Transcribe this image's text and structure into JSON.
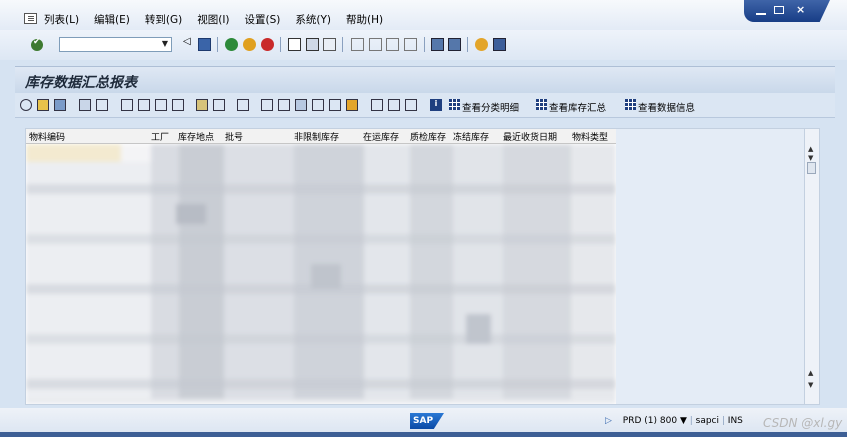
{
  "menubar": {
    "items": [
      "列表(L)",
      "编辑(E)",
      "转到(G)",
      "视图(I)",
      "设置(S)",
      "系统(Y)",
      "帮助(H)"
    ]
  },
  "standard_toolbar": {
    "command_field_value": ""
  },
  "title": "库存数据汇总报表",
  "app_toolbar": {
    "buttons": [
      "查看分类明细",
      "查看库存汇总",
      "查看数据信息"
    ]
  },
  "grid": {
    "columns": [
      "物料编码",
      "工厂",
      "库存地点",
      "批号",
      "非限制库存",
      "在运库存",
      "质检库存",
      "冻结库存",
      "最近收货日期",
      "物料类型"
    ]
  },
  "statusbar": {
    "logo": "SAP",
    "system": "PRD (1) 800",
    "server": "sapci",
    "mode": "INS",
    "watermark": "CSDN @xl.gy"
  },
  "colors": {
    "background": "#d6e3f2",
    "title_text": "#1e2a3a",
    "window_controls": "#1f4c96",
    "sap_logo": "#0a4aa6"
  }
}
